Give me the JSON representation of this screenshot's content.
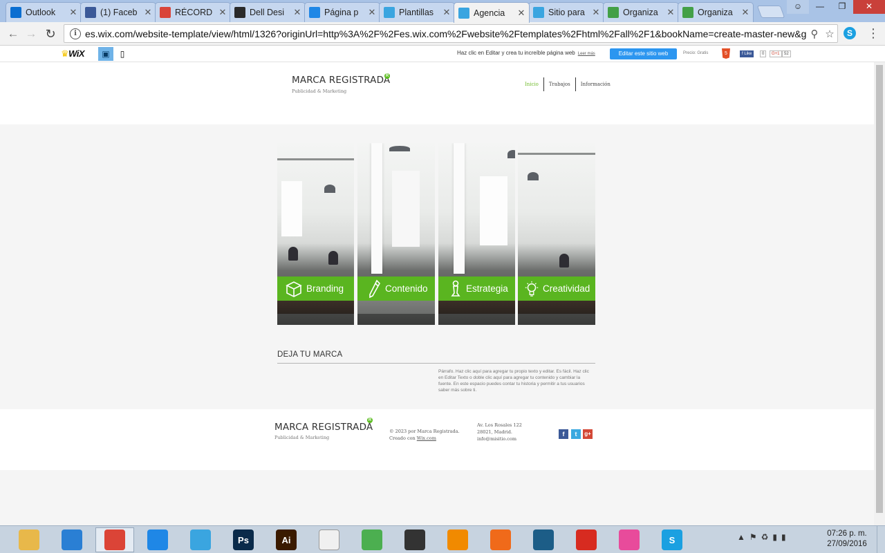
{
  "browser": {
    "tabs": [
      {
        "label": "Outlook",
        "icon": "outlook-icon",
        "color": "#0a6ed1"
      },
      {
        "label": "(1) Faceb",
        "icon": "facebook-icon",
        "color": "#3b5998"
      },
      {
        "label": "RÉCORD",
        "icon": "record-icon",
        "color": "#d9443a"
      },
      {
        "label": "Dell Desi",
        "icon": "dell-icon",
        "color": "#2a2a2a"
      },
      {
        "label": "Página p",
        "icon": "dropbox-icon",
        "color": "#1f87e6"
      },
      {
        "label": "Plantillas",
        "icon": "wix-icon",
        "color": "#3aa5e0"
      },
      {
        "label": "Agencia",
        "icon": "wix-icon",
        "color": "#3aa5e0",
        "active": true
      },
      {
        "label": "Sitio para",
        "icon": "wix-icon",
        "color": "#3aa5e0"
      },
      {
        "label": "Organiza",
        "icon": "plus-icon",
        "color": "#43a047"
      },
      {
        "label": "Organiza",
        "icon": "plus-icon",
        "color": "#43a047"
      }
    ],
    "url": "es.wix.com/website-template/view/html/1326?originUrl=http%3A%2F%2Fes.wix.com%2Fwebsite%2Ftemplates%2Fhtml%2Fall%2F1&bookName=create-master-new&ga"
  },
  "wixbar": {
    "logo": "WiX",
    "message": "Haz clic en Editar y crea tu increíble página web",
    "more_link": "Leer más",
    "edit_button": "Editar este sitio web",
    "price": "Precio: Gratis",
    "fb_like": "Like",
    "count1": "0",
    "gplus": "G+1",
    "count2": "52"
  },
  "site": {
    "brand": "MARCA REGISTRADA",
    "tagline": "Publicidad & Marketing",
    "nav": [
      "Inicio",
      "Trabajos",
      "Información"
    ],
    "panels": [
      {
        "label": "Branding",
        "icon": "box-icon"
      },
      {
        "label": "Contenido",
        "icon": "pencil-icon"
      },
      {
        "label": "Estrategia",
        "icon": "chess-pawn-icon"
      },
      {
        "label": "Creatividad",
        "icon": "lightbulb-icon"
      }
    ],
    "section_title": "DEJA TU MARCA",
    "paragraph": "Párrafo. Haz clic aquí para agregar tu propio texto y editar. Es fácil. Haz clic en Editar Texto o doble clic aquí para agregar tu contenido y cambiar la fuente. En este espacio puedes contar tu historia y permitir a tus usuarios saber más sobre ti.",
    "footer": {
      "brand": "MARCA REGISTRADA",
      "tagline": "Publicidad & Marketing",
      "copyright": "© 2023 por Marca Registrada.",
      "created_with_prefix": "Creado con",
      "created_with_link": "Wix.com",
      "address1": "Av. Los Rosales 122",
      "address2": "28021, Madrid.",
      "email": "info@misitio.com"
    }
  },
  "taskbar": {
    "items": [
      {
        "name": "file-explorer",
        "color": "#e8b84a"
      },
      {
        "name": "internet-explorer",
        "color": "#2a7fd4"
      },
      {
        "name": "chrome",
        "color": "#db4437",
        "active": true
      },
      {
        "name": "dropbox",
        "color": "#1f87e6"
      },
      {
        "name": "sketchbook",
        "color": "#3aa5e0"
      },
      {
        "name": "photoshop",
        "color": "#0a2a4a",
        "text": "Ps"
      },
      {
        "name": "illustrator",
        "color": "#3a1a00",
        "text": "Ai"
      },
      {
        "name": "notepad",
        "color": "#f0f0f0"
      },
      {
        "name": "sketchup-layout",
        "color": "#4caf50"
      },
      {
        "name": "webcam",
        "color": "#333333"
      },
      {
        "name": "avast",
        "color": "#f18a00"
      },
      {
        "name": "helm",
        "color": "#f06a1a"
      },
      {
        "name": "brackets",
        "color": "#1c5d87"
      },
      {
        "name": "sketchup",
        "color": "#d72b20"
      },
      {
        "name": "itunes",
        "color": "#e84b9b"
      },
      {
        "name": "skype",
        "color": "#1ba0e1",
        "text": "S"
      }
    ],
    "time": "07:26 p. m.",
    "date": "27/09/2016"
  },
  "colors": {
    "accent_green": "#5ab520",
    "wix_blue": "#2c96f0"
  }
}
